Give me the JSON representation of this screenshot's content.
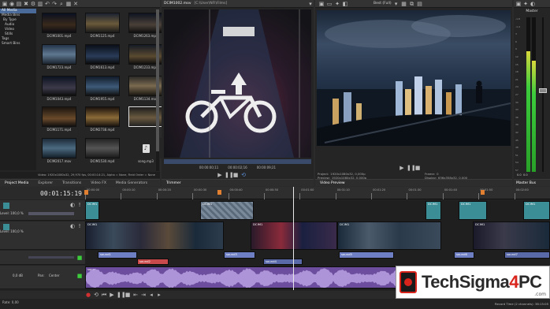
{
  "explorer": {
    "tree": [
      "All Media",
      "Media Bins",
      "By Type",
      "Audio",
      "Video",
      "Stills",
      "Tags",
      "Smart Bins"
    ],
    "thumbs": [
      {
        "name": "DCIM1001.mp4"
      },
      {
        "name": "DCIM1125.mp4"
      },
      {
        "name": "DCIM1263.mp4"
      },
      {
        "name": "DCIM1723.mp4"
      },
      {
        "name": "DCIM1613.mp4"
      },
      {
        "name": "DCIM1233.mp4"
      },
      {
        "name": "DCIM1043.mp4"
      },
      {
        "name": "DCIM1955.mp4"
      },
      {
        "name": "DCIM1134.mov"
      },
      {
        "name": "DCIM1171.mp4"
      },
      {
        "name": "DCIM2738.mp4"
      },
      {
        "name": ""
      },
      {
        "name": "DCIM2017.mov"
      },
      {
        "name": "DCIM1530.mp4"
      },
      {
        "name": "song.mp3"
      }
    ],
    "status": "Video: 1920x1080x32, 29,970 fps, 00:00:14:21, Alpha = None, Field Order = None"
  },
  "bottom_tabs": {
    "left": [
      "Project Media",
      "Explorer",
      "Transitions",
      "Video FX",
      "Media Generators"
    ],
    "trimmer": [
      "Trimmer"
    ],
    "preview": [
      "Video Preview"
    ],
    "master": [
      "Master Bus"
    ]
  },
  "trimmer": {
    "title": "DCIM1002.mov",
    "path": "[C:\\User\\NFI\\Films]",
    "time_in": "00:00:00;11",
    "time_out": "00:00:09;21",
    "time_len": "00:00:02;16"
  },
  "preview": {
    "quality": "Best (Full)",
    "info_left_label": "Project:",
    "info_left_value": "1920x1080x32, 0,000p",
    "info_left2_label": "Preview:",
    "info_left2_value": "1920x1080x32, 0,000p",
    "info_right_label": "Frame:",
    "info_right_value": "0",
    "info_right2_label": "Display:",
    "info_right2_value": "636x358x32, 0,000"
  },
  "master": {
    "title": "Master",
    "scale": [
      "-1.8",
      "-1.4",
      "3",
      "6",
      "9",
      "12",
      "15",
      "18",
      "21",
      "24",
      "27",
      "30",
      "33",
      "36",
      "39",
      "42",
      "45",
      "48",
      "51",
      "54",
      "57"
    ],
    "level_left": 0.78,
    "level_right": 0.72,
    "readout": "0.0  0.0"
  },
  "timeline": {
    "timecode": "00:01:15:19",
    "ruler": [
      "00:00:00",
      "00:00:10",
      "00:00:20",
      "00:00:30",
      "00:00:40",
      "00:00:50",
      "00:01:00",
      "00:01:10",
      "00:01:20",
      "00:01:30",
      "00:01:40",
      "00:01:50",
      "00:02:00"
    ],
    "track1_label": "Level: 100,0 %",
    "track2_label": "Level: 100,0 %",
    "track_audio_vol": "0,0 dB",
    "track_audio_pan": "Pan:",
    "track_audio_pan_val": "Center",
    "video_clips": [
      "DCIM1",
      "DCIM1",
      "DCIM1",
      "DCIM1",
      "DCIM1",
      "DCIM1",
      "DCIM1",
      "DCIM1",
      "DCIM1"
    ],
    "audio_clips": [
      "sound1",
      "sound2",
      "sound3",
      "sound4",
      "sound5",
      "sound6",
      "sound7"
    ],
    "music_clip": "song",
    "rate": "Rate: 0,00",
    "record_time": "Record Time (2 channels): 38:15:05"
  },
  "watermark": {
    "text_a": "Tech",
    "text_b": "Sigma",
    "text_c": "4",
    "text_d": "PC",
    "suffix": ".com"
  },
  "colors": {
    "accent": "#4a6a9a",
    "video_track": "#3b8e96",
    "audio_track": "#6e7fc4",
    "music_track": "#6c4d9e",
    "meter_green": "#3ccc3c",
    "watermark_red": "#d9241c"
  }
}
